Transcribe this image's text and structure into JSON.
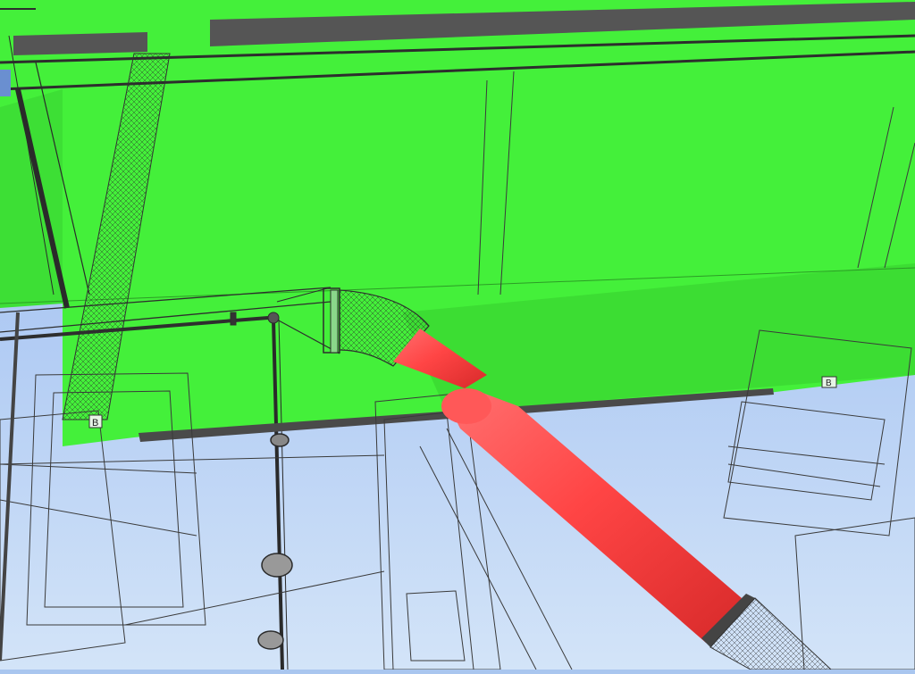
{
  "scene": {
    "colors": {
      "sky_top": "#8fb3ef",
      "sky_bottom": "#cfe1f7",
      "slab_green": "#44f03a",
      "slab_green_shadow": "#39d92f",
      "clash_red": "#ff4a4a",
      "wire": "#2d2d2d"
    },
    "labels": {
      "tag_left": "B",
      "tag_right": "B"
    }
  }
}
